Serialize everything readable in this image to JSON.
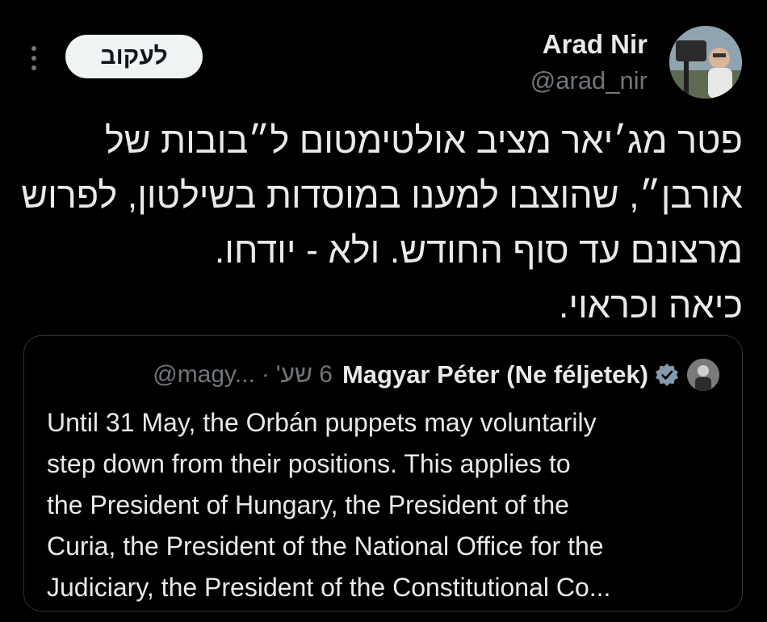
{
  "author": {
    "name": "Arad Nir",
    "handle": "@arad_nir"
  },
  "follow_button": {
    "label": "לעקוב"
  },
  "tweet_lines": [
    "פטר מג׳יאר מציב אולטימטום ל״בובות של",
    "אורבן״, שהוצבו למענו במוסדות בשילטון, לפרוש",
    "מרצונם עד סוף החודש. ולא - יודחו.",
    "כיאה וכראוי."
  ],
  "quote": {
    "author_name": "Magyar Péter (Ne féljetek)",
    "handle": "@magy...",
    "separator": "·",
    "time": "6 שע'",
    "lines": [
      "Until 31 May, the Orbán puppets may voluntarily",
      "step down from their positions. This applies to",
      "the President of Hungary, the President of the",
      "Curia, the President of the National Office for the",
      "Judiciary, the President of the Constitutional Co..."
    ]
  },
  "colors": {
    "background": "#000000",
    "text": "#e7e9ea",
    "secondary_text": "#71767b",
    "border": "#2f3336",
    "follow_button_bg": "#eff3f4",
    "verified_badge": "#829aab"
  },
  "icons": {
    "more": "more-dots-icon",
    "verified": "verified-badge-icon"
  }
}
